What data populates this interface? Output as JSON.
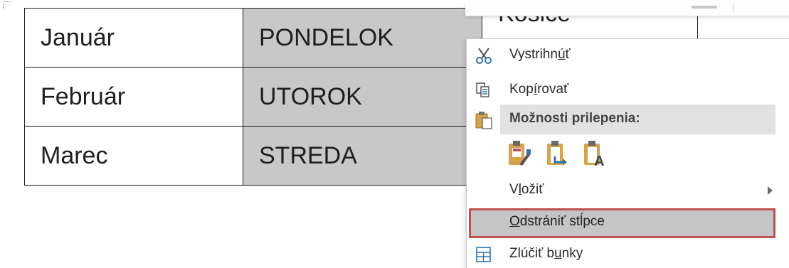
{
  "table": {
    "rows": [
      [
        "Január",
        "PONDELOK",
        "Košice"
      ],
      [
        "Február",
        "UTOROK",
        ""
      ],
      [
        "Marec",
        "STREDA",
        ""
      ]
    ]
  },
  "context_menu": {
    "cut": {
      "pre": "Vystrihn",
      "u": "ú",
      "post": "ť",
      "icon": "scissors-icon"
    },
    "copy": {
      "pre": "Kop",
      "u": "í",
      "post": "rovať",
      "icon": "copy-icon"
    },
    "paste_options": {
      "label": "Možnosti prilepenia:",
      "icon": "clipboard-icon",
      "options": [
        "paste-keep-formatting-icon",
        "paste-merge-formatting-icon",
        "paste-keep-text-only-icon"
      ]
    },
    "insert": {
      "pre": "V",
      "u": "l",
      "post": "ožiť",
      "icon": "submenu-arrow-icon"
    },
    "delete_columns": {
      "pre": "",
      "u": "O",
      "post": "dstrániť stĺpce",
      "highlighted": true
    },
    "merge_cells": {
      "pre": "Zlúčiť b",
      "u": "u",
      "post": "nky",
      "icon": "merge-cells-icon"
    }
  },
  "colors": {
    "highlight_border": "#c0504d",
    "shaded_cell": "#c8c8c8"
  }
}
